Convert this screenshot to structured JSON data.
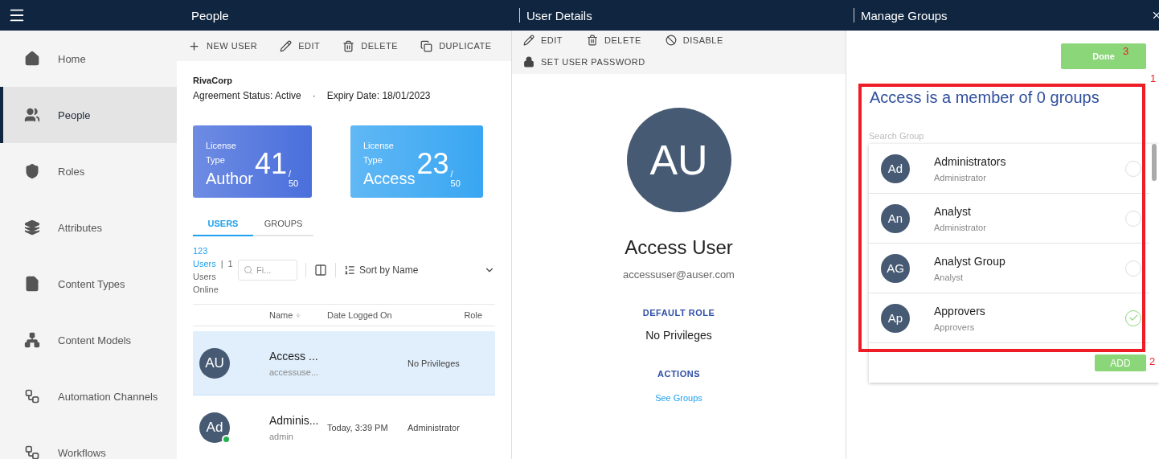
{
  "header": {
    "panels": [
      "People",
      "User Details",
      "Manage Groups"
    ]
  },
  "sidebar": {
    "items": [
      {
        "label": "Home",
        "selected": false
      },
      {
        "label": "People",
        "selected": true
      },
      {
        "label": "Roles",
        "selected": false
      },
      {
        "label": "Attributes",
        "selected": false
      },
      {
        "label": "Content Types",
        "selected": false
      },
      {
        "label": "Content Models",
        "selected": false
      },
      {
        "label": "Automation Channels",
        "selected": false
      },
      {
        "label": "Workflows",
        "selected": false
      }
    ]
  },
  "people": {
    "toolbar": [
      "NEW USER",
      "EDIT",
      "DELETE",
      "DUPLICATE"
    ],
    "company": "RivaCorp",
    "agreement": "Agreement Status: Active",
    "separator": "·",
    "expiry": "Expiry Date: 18/01/2023",
    "licenses": [
      {
        "caption_1": "License",
        "caption_2": "Type",
        "type": "Author",
        "used": "41",
        "slash": "/",
        "total": "50",
        "color": "#4a6fdc"
      },
      {
        "caption_1": "License",
        "caption_2": "Type",
        "type": "Access",
        "used": "23",
        "slash": "/",
        "total": "50",
        "color": "#39a6f2"
      }
    ],
    "tabs": [
      {
        "label": "USERS",
        "selected": true
      },
      {
        "label": "GROUPS",
        "selected": false
      }
    ],
    "stats": {
      "count": "123",
      "count_label": "Users",
      "divider": "|",
      "online": "1",
      "online_label": "Users Online"
    },
    "filter": {
      "placeholder": "Fi..."
    },
    "sort": "Sort by Name",
    "columns": [
      "Name",
      "Date Logged On",
      "Role"
    ],
    "rows": [
      {
        "initials": "AU",
        "name": "Access ...",
        "email": "accessuse...",
        "role": "No Privileges",
        "selected": true,
        "online": false
      },
      {
        "initials": "Ad",
        "name": "Adminis...",
        "email": "admin",
        "date": "Today, 3:39 PM",
        "role": "Administrator",
        "selected": false,
        "online": true
      }
    ]
  },
  "details": {
    "toolbar": [
      "EDIT",
      "DELETE",
      "DISABLE"
    ],
    "password_action": "SET USER PASSWORD",
    "initials": "AU",
    "name": "Access User",
    "email": "accessuser@auser.com",
    "default_role_label": "DEFAULT ROLE",
    "default_role": "No Privileges",
    "actions_label": "ACTIONS",
    "see_groups": "See Groups"
  },
  "manage": {
    "done": "Done",
    "heading": "Access is a member of 0 groups",
    "search": {
      "placeholder": "Search Group"
    },
    "groups": [
      {
        "initials": "Ad",
        "name": "Administrators",
        "role": "Administrator",
        "selected": false
      },
      {
        "initials": "An",
        "name": "Analyst",
        "role": "Administrator",
        "selected": false
      },
      {
        "initials": "AG",
        "name": "Analyst Group",
        "role": "Analyst",
        "selected": false
      },
      {
        "initials": "Ap",
        "name": "Approvers",
        "role": "Approvers",
        "selected": true
      }
    ],
    "add": "ADD",
    "callouts": [
      "1",
      "2",
      "3"
    ]
  }
}
